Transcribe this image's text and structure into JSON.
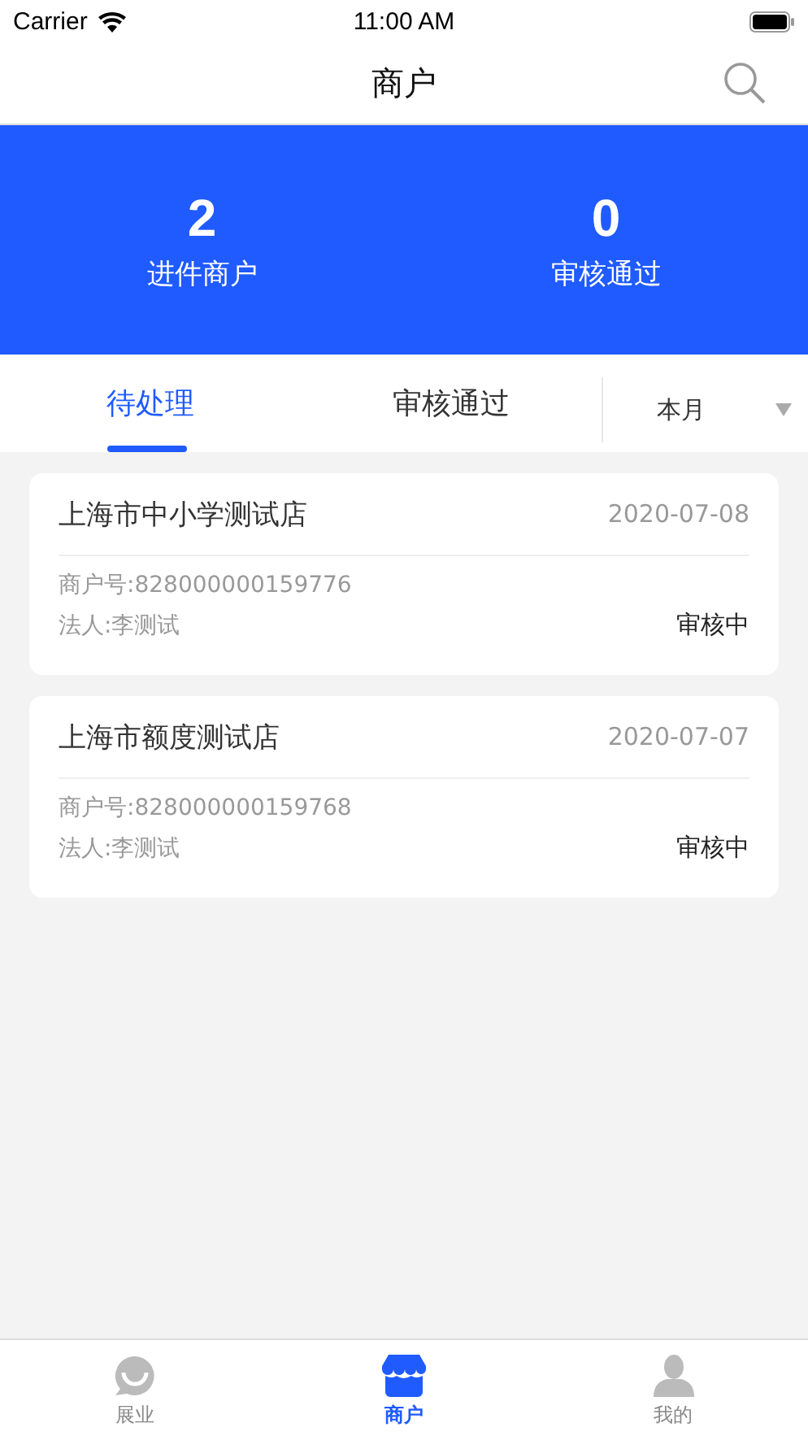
{
  "status_bar": {
    "carrier": "Carrier",
    "time": "11:00 AM"
  },
  "nav": {
    "title": "商户"
  },
  "stats": [
    {
      "value": "2",
      "label": "进件商户"
    },
    {
      "value": "0",
      "label": "审核通过"
    }
  ],
  "tabs": [
    {
      "label": "待处理",
      "selected": true
    },
    {
      "label": "审核通过",
      "selected": false
    }
  ],
  "period": {
    "value": "本月"
  },
  "merchants": [
    {
      "name": "上海市中小学测试店",
      "date": "2020-07-08",
      "merchant_no": "商户号:828000000159776",
      "legal_person": "法人:李测试",
      "status": "审核中"
    },
    {
      "name": "上海市额度测试店",
      "date": "2020-07-07",
      "merchant_no": "商户号:828000000159768",
      "legal_person": "法人:李测试",
      "status": "审核中"
    }
  ],
  "bottom_tabs": [
    {
      "label": "展业",
      "kind": "chat",
      "selected": false
    },
    {
      "label": "商户",
      "kind": "shop",
      "selected": true
    },
    {
      "label": "我的",
      "kind": "person",
      "selected": false
    }
  ]
}
